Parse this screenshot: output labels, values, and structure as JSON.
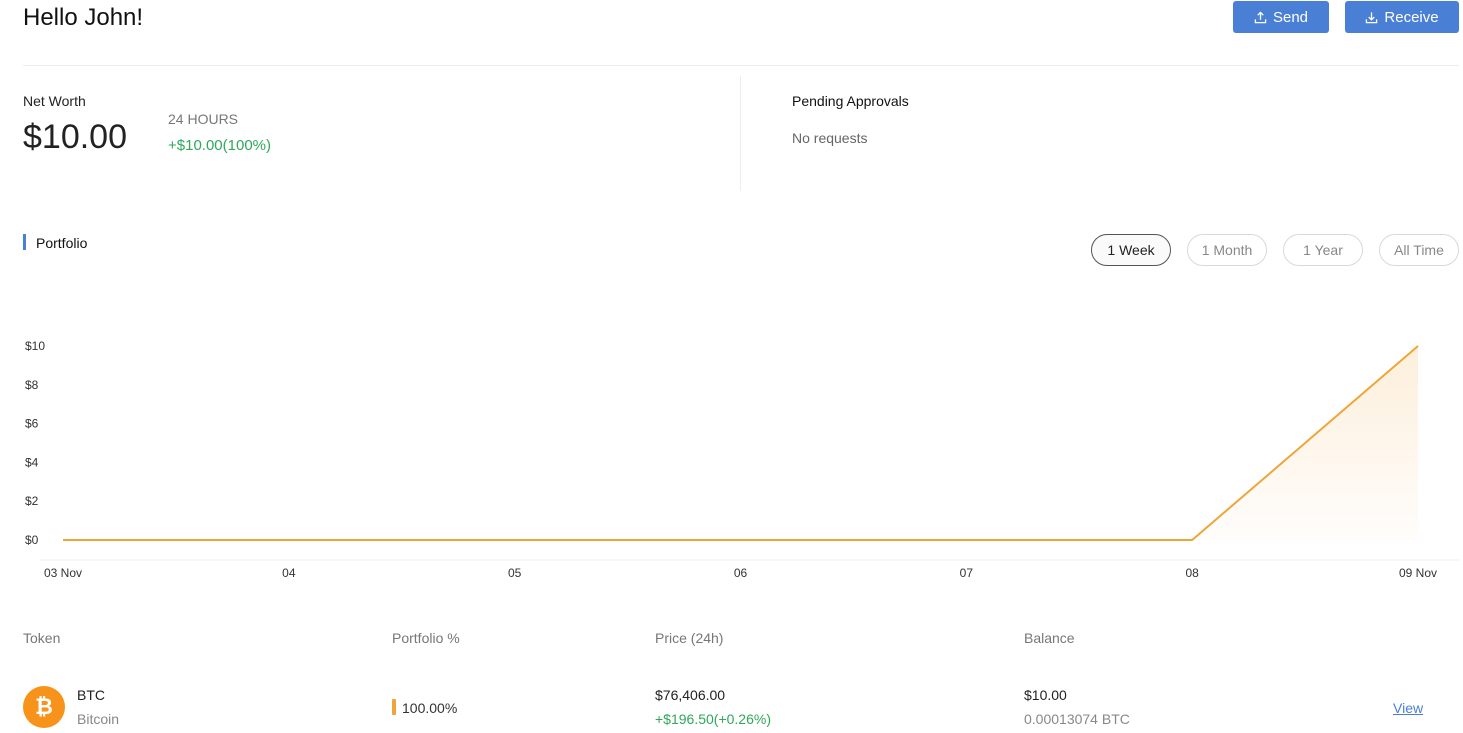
{
  "header": {
    "greeting": "Hello John!",
    "send_label": "Send",
    "receive_label": "Receive"
  },
  "summary": {
    "net_worth_label": "Net Worth",
    "net_worth_value": "$10.00",
    "period_label": "24 HOURS",
    "period_change": "+$10.00(100%)",
    "pending_title": "Pending Approvals",
    "pending_empty": "No requests"
  },
  "portfolio": {
    "title": "Portfolio",
    "ranges": [
      "1 Week",
      "1 Month",
      "1 Year",
      "All Time"
    ],
    "active_range": "1 Week"
  },
  "chart_data": {
    "type": "area",
    "x": [
      "03 Nov",
      "04",
      "05",
      "06",
      "07",
      "08",
      "09 Nov"
    ],
    "series": [
      {
        "values": [
          0,
          0,
          0,
          0,
          0,
          0,
          10
        ]
      }
    ],
    "yticks": [
      "$0",
      "$2",
      "$4",
      "$6",
      "$8",
      "$10"
    ],
    "ylim": [
      0,
      10
    ],
    "grid": false,
    "color": "#f0a53a"
  },
  "table": {
    "headers": [
      "Token",
      "Portfolio %",
      "Price (24h)",
      "Balance"
    ],
    "rows": [
      {
        "icon": "bitcoin-icon",
        "symbol": "BTC",
        "name": "Bitcoin",
        "portfolio_pct": "100.00%",
        "portfolio_fraction": 1.0,
        "price": "$76,406.00",
        "price_change": "+$196.50(+0.26%)",
        "balance_usd": "$10.00",
        "balance_coin": "0.00013074 BTC",
        "action": "View"
      }
    ]
  },
  "colors": {
    "accent": "#4a7fd6",
    "positive": "#2fa85a",
    "chart_line": "#f0a53a",
    "bitcoin": "#f7931a"
  }
}
